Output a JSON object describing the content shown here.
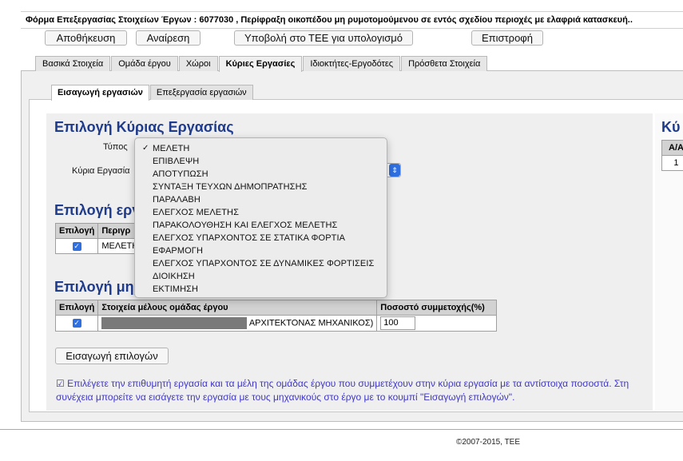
{
  "window": {
    "title": "Φόρμα Επεξεργασίας Στοιχείων Έργων : 6077030 , Περίφραξη οικοπέδου μη ρυμοτομούμενου σε εντός σχεδίου περιοχές με ελαφριά κατασκευή.."
  },
  "toolbar": {
    "save": "Αποθήκευση",
    "cancel": "Αναίρεση",
    "submit": "Υποβολή στο ΤΕΕ για υπολογισμό",
    "back": "Επιστροφή"
  },
  "main_tabs": [
    {
      "label": "Βασικά Στοιχεία",
      "active": false
    },
    {
      "label": "Ομάδα έργου",
      "active": false
    },
    {
      "label": "Χώροι",
      "active": false
    },
    {
      "label": "Κύριες Εργασίες",
      "active": true
    },
    {
      "label": "Ιδιοκτήτες-Εργοδότες",
      "active": false
    },
    {
      "label": "Πρόσθετα Στοιχεία",
      "active": false
    }
  ],
  "sub_tabs": [
    {
      "label": "Εισαγωγή εργασιών",
      "active": true
    },
    {
      "label": "Επεξεργασία εργασιών",
      "active": false
    }
  ],
  "section1": {
    "title": "Επιλογή Κύριας Εργασίας",
    "type_label": "Τύπος",
    "work_label": "Κύρια Εργασία"
  },
  "dropdown": {
    "selected": "ΜΕΛΕΤΗ",
    "options": [
      "ΜΕΛΕΤΗ",
      "ΕΠΙΒΛΕΨΗ",
      "ΑΠΟΤΥΠΩΣΗ",
      "ΣΥΝΤΑΞΗ ΤΕΥΧΩΝ ΔΗΜΟΠΡΑΤΗΣΗΣ",
      "ΠΑΡΑΛΑΒΗ",
      "ΕΛΕΓΧΟΣ ΜΕΛΕΤΗΣ",
      "ΠΑΡΑΚΟΛΟΥΘΗΣΗ ΚΑΙ ΕΛΕΓΧΟΣ ΜΕΛΕΤΗΣ",
      "ΕΛΕΓΧΟΣ ΥΠΑΡΧΟΝΤΟΣ ΣΕ ΣΤΑΤΙΚΑ ΦΟΡΤΙΑ",
      "ΕΦΑΡΜΟΓΗ",
      "ΕΛΕΓΧΟΣ ΥΠΑΡΧΟΝΤΟΣ ΣΕ ΔΥΝΑΜΙΚΕΣ ΦΟΡΤΙΣΕΙΣ",
      "ΔΙΟΙΚΗΣΗ",
      "ΕΚΤΙΜΗΣΗ"
    ]
  },
  "section2": {
    "title": "Επιλογή εργ",
    "col_select": "Επιλογή",
    "col_desc": "Περιγρ",
    "row_desc": "ΜΕΛΕΤΗ"
  },
  "section3": {
    "title": "Επιλογή μηχ",
    "col_select": "Επιλογή",
    "col_member": "Στοιχεία μέλους ομάδας έργου",
    "col_pct": "Ποσοστό συμμετοχής(%)",
    "row_role": "ΑΡΧΙΤΕΚΤΟΝΑΣ ΜΗΧΑΝΙΚΟΣ)",
    "row_pct": "100"
  },
  "insert_button": "Εισαγωγή επιλογών",
  "right_panel": {
    "title": "Κύ",
    "col": "Α/Α",
    "row": "1"
  },
  "info_text": "Επιλέγετε την επιθυμητή εργασία και τα μέλη της ομάδας έργου που συμμετέχουν στην κύρια εργασία με τα αντίστοιχα ποσοστά. Στη συνέχεια μπορείτε να εισάγετε την εργασία με τους μηχανικούς στο έργο με το κουμπί \"Εισαγωγή επιλογών\".",
  "footer": "©2007-2015, ΤΕΕ",
  "colors": {
    "heading": "#1f3b8c",
    "info": "#3f37c9",
    "checkbox": "#2f6fe0"
  }
}
